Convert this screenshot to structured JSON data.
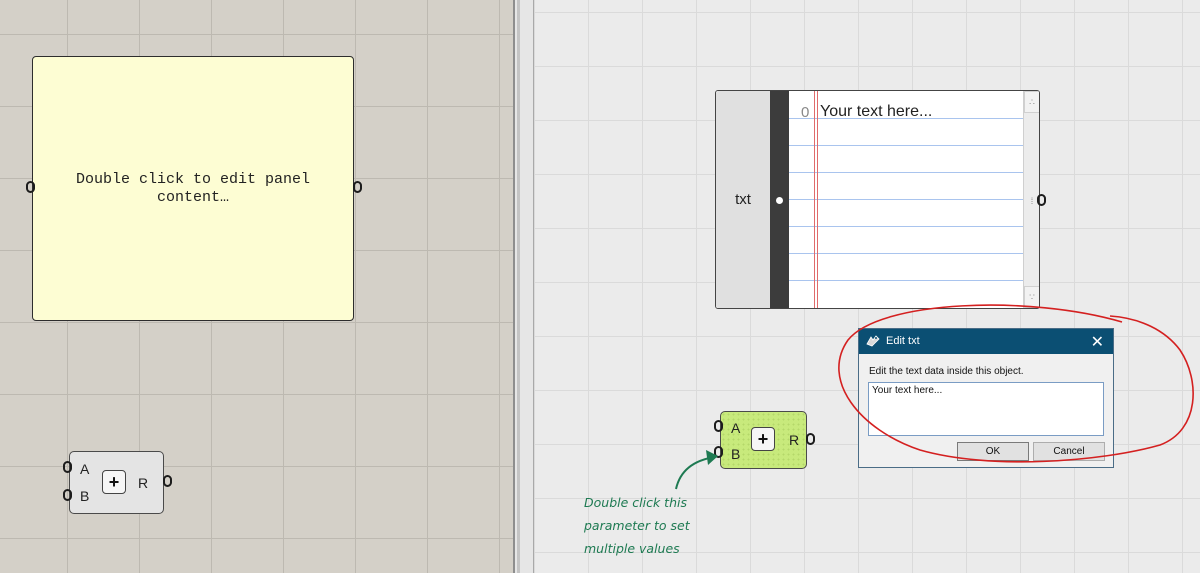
{
  "left_canvas": {
    "panel": {
      "content": "Double click to edit panel content…"
    },
    "addition_component": {
      "input_a": "A",
      "input_b": "B",
      "output": "R",
      "operator": "+"
    }
  },
  "right_canvas": {
    "text_panel": {
      "param_label": "txt",
      "line_index": "0",
      "line_text": "Your text here..."
    },
    "addition_component": {
      "input_a": "A",
      "input_b": "B",
      "output": "R",
      "operator": "+"
    },
    "edit_dialog": {
      "title": "Edit txt",
      "prompt": "Edit the text data inside this object.",
      "value": "Your text here...",
      "ok_label": "OK",
      "cancel_label": "Cancel",
      "close_glyph": "✕"
    },
    "annotation": "Double click this\nparameter to set\nmultiple values"
  },
  "colors": {
    "left_canvas_bg": "#d4d0c8",
    "right_canvas_bg": "#ebebeb",
    "panel_fill": "#fdfdd3",
    "component_green": "#c8ea7c",
    "dialog_title_bg": "#0b4f73",
    "annotation_green": "#1e7a52",
    "highlight_red": "#d42020"
  },
  "icons": {
    "dialog_app": "grasshopper-icon",
    "scroll_up": "dots-up-icon",
    "scroll_down": "dots-down-icon",
    "grip": "grip-dots-icon"
  }
}
